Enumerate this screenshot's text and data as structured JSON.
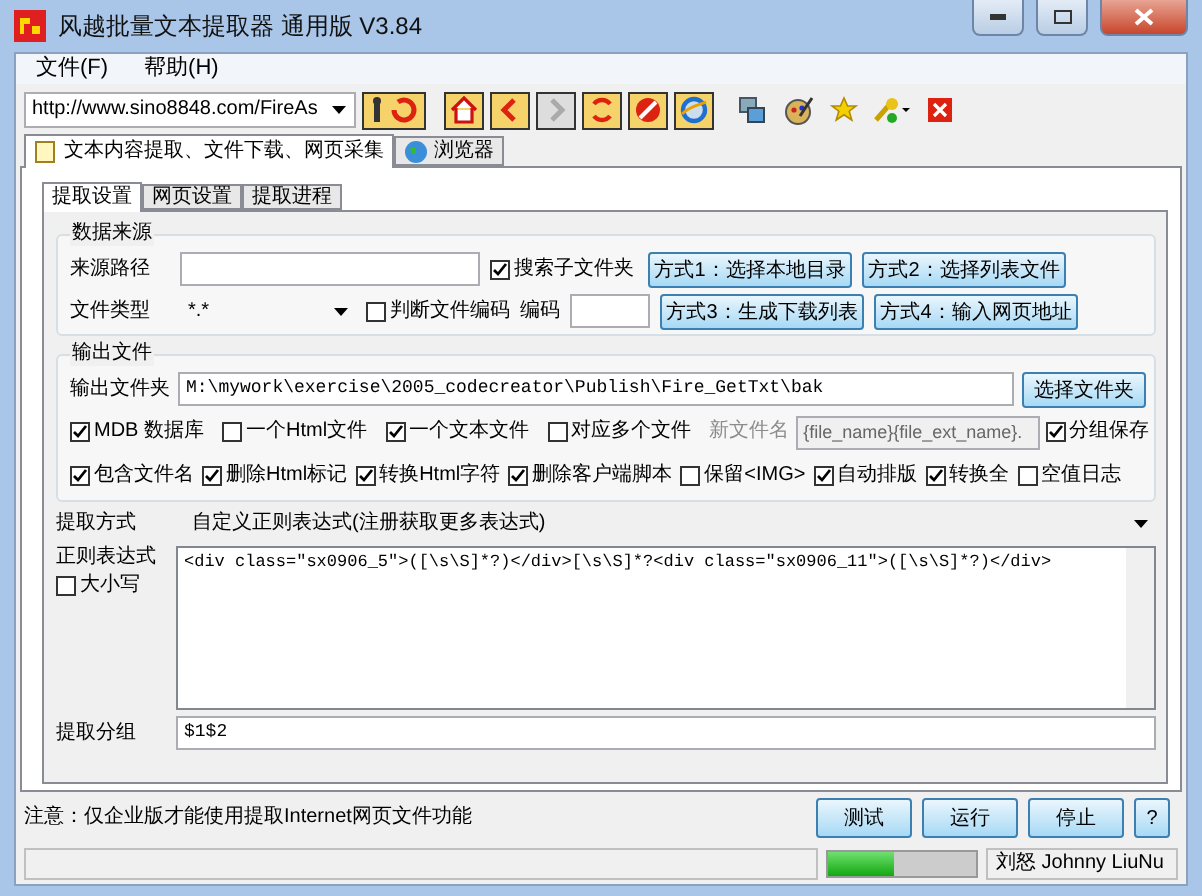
{
  "window": {
    "title": "风越批量文本提取器 通用版 V3.84"
  },
  "menu": [
    "文件(F)",
    "帮助(H)"
  ],
  "toolbar": {
    "url": "http://www.sino8848.com/FireAs",
    "buttons": [
      {
        "kind": "go",
        "disabled": false
      },
      {
        "kind": "home",
        "disabled": false
      },
      {
        "kind": "back",
        "disabled": false
      },
      {
        "kind": "forward",
        "disabled": true
      },
      {
        "kind": "refresh",
        "disabled": false
      },
      {
        "kind": "stop",
        "disabled": false
      },
      {
        "kind": "browser",
        "disabled": false
      },
      {
        "kind": "windows",
        "disabled": false
      },
      {
        "kind": "palette",
        "disabled": false
      },
      {
        "kind": "star",
        "disabled": false
      },
      {
        "kind": "key",
        "disabled": false
      },
      {
        "kind": "close",
        "disabled": false
      }
    ]
  },
  "main_tabs": [
    {
      "label": "文本内容提取、文件下载、网页采集",
      "selected": true
    },
    {
      "label": "浏览器",
      "selected": false
    }
  ],
  "sub_tabs": [
    {
      "label": "提取设置",
      "selected": true
    },
    {
      "label": "网页设置",
      "selected": false
    },
    {
      "label": "提取进程",
      "selected": false
    }
  ],
  "source": {
    "title": "数据来源",
    "path_label": "来源路径",
    "search_subfolders": {
      "label": "搜索子文件夹",
      "checked": true
    },
    "type_label": "文件类型",
    "type_value": "*.*",
    "detect_encoding": {
      "label": "判断文件编码",
      "checked": false
    },
    "encoding_label": "编码",
    "buttons": [
      "方式1：选择本地目录",
      "方式2：选择列表文件",
      "方式3：生成下载列表",
      "方式4：输入网页地址"
    ]
  },
  "output": {
    "title": "输出文件",
    "folder_label": "输出文件夹",
    "folder_value": "M:\\mywork\\exercise\\2005_codecreator\\Publish\\Fire_GetTxt\\bak",
    "folder_button": "选择文件夹",
    "row1": [
      {
        "kind": "checkbox",
        "label": "MDB 数据库",
        "checked": true
      },
      {
        "kind": "checkbox",
        "label": "一个Html文件",
        "checked": false
      },
      {
        "kind": "checkbox",
        "label": "一个文本文件",
        "checked": true
      },
      {
        "kind": "checkbox",
        "label": "对应多个文件",
        "checked": false
      },
      {
        "kind": "label",
        "label": "新文件名"
      },
      {
        "kind": "field",
        "label": "{file_name}{file_ext_name}."
      },
      {
        "kind": "checkbox",
        "label": "分组保存",
        "checked": true
      }
    ],
    "row2": [
      {
        "kind": "checkbox",
        "label": "包含文件名",
        "checked": true
      },
      {
        "kind": "checkbox",
        "label": "删除Html标记",
        "checked": true
      },
      {
        "kind": "checkbox",
        "label": "转换Html字符",
        "checked": true
      },
      {
        "kind": "checkbox",
        "label": "删除客户端脚本",
        "checked": true
      },
      {
        "kind": "checkbox",
        "label": "保留<IMG>",
        "checked": false
      },
      {
        "kind": "checkbox",
        "label": "自动排版",
        "checked": true
      },
      {
        "kind": "checkbox",
        "label": "转换全",
        "checked": true
      },
      {
        "kind": "checkbox",
        "label": "空值日志",
        "checked": false
      }
    ]
  },
  "method": {
    "label": "提取方式",
    "value": "自定义正则表达式(注册获取更多表达式)"
  },
  "regex": {
    "label": "正则表达式",
    "case": {
      "label": "大小写",
      "checked": false
    },
    "value": "<div class=\"sx0906_5\">([\\s\\S]*?)</div>[\\s\\S]*?<div class=\"sx0906_11\">([\\s\\S]*?)</div>"
  },
  "group": {
    "label": "提取分组",
    "value": "$1$2"
  },
  "note": "注意：仅企业版才能使用提取Internet网页文件功能",
  "actions": [
    "测试",
    "运行",
    "停止",
    "?"
  ],
  "status_bar": {
    "progress": {
      "level": 0.45
    },
    "author": "刘怒 Johnny LiuNu"
  }
}
